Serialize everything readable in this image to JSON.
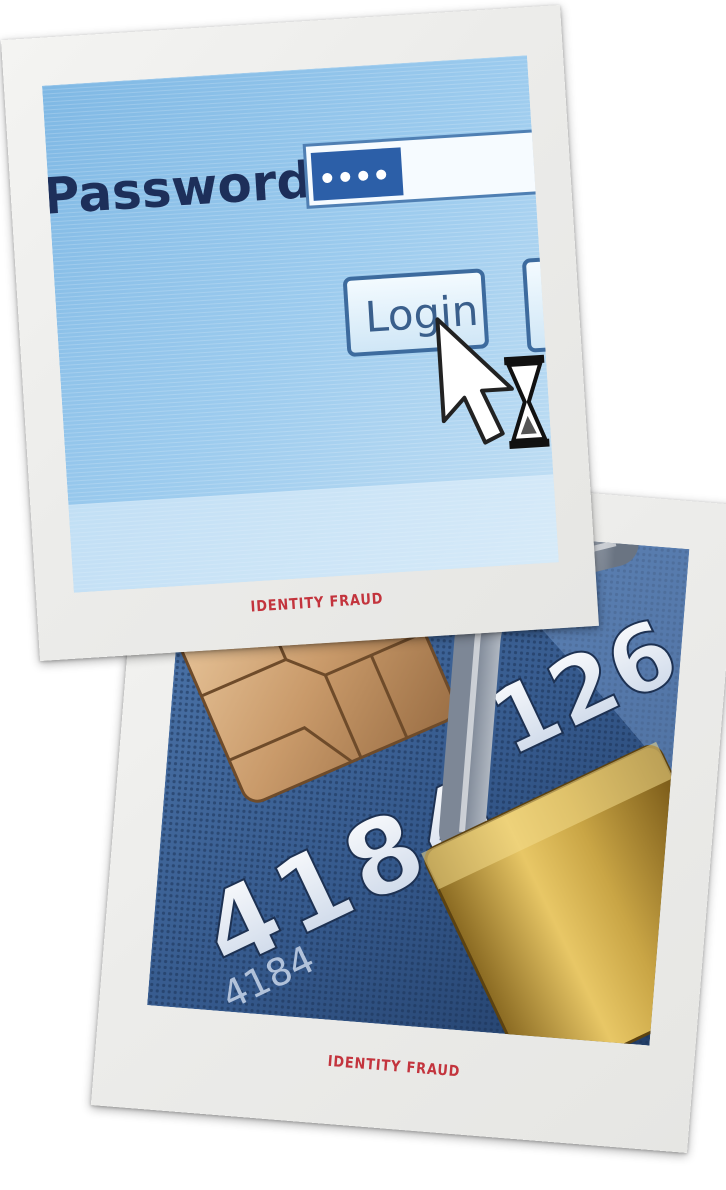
{
  "photos": [
    {
      "caption": "IDENTITY FRAUD",
      "scene": {
        "field_label": "Password:",
        "button_label": "Login"
      }
    },
    {
      "caption": "IDENTITY FRAUD",
      "scene": {
        "embossed_number": "4184",
        "small_number": "4184",
        "partial_number": "126"
      }
    }
  ],
  "colors": {
    "caption_red": "#c3343d",
    "screen_blue": "#7fb8e4",
    "card_blue": "#3a5f93",
    "padlock_gold": "#c9a545"
  }
}
